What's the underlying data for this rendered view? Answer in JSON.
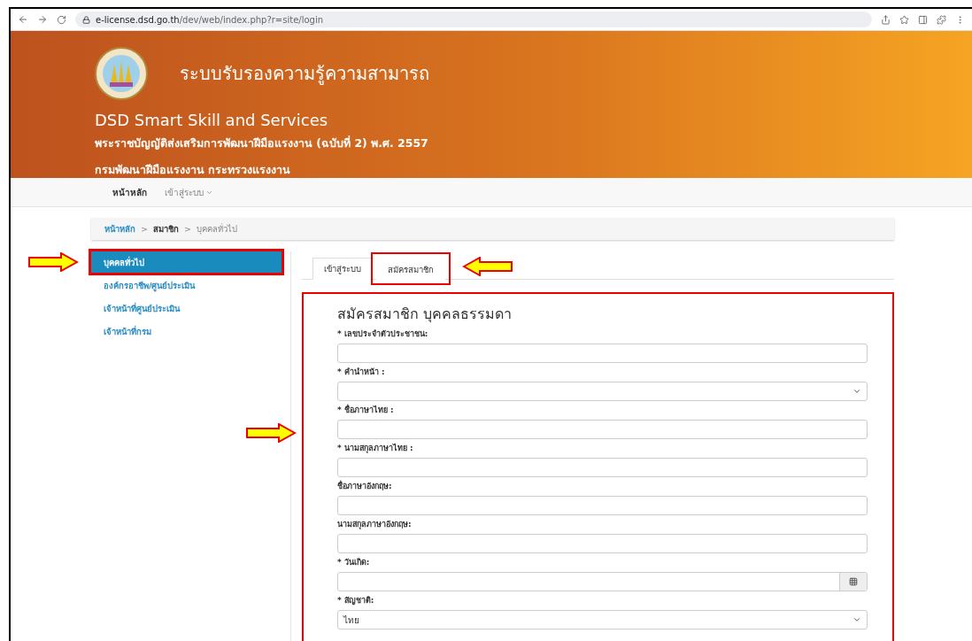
{
  "browser": {
    "url_host": "e-license.dsd.go.th",
    "url_path": "/dev/web/index.php?r=site/login"
  },
  "header": {
    "title": "ระบบรับรองความรู้ความสามารถ",
    "subtitle": "DSD Smart Skill and Services",
    "act": "พระราชบัญญัติส่งเสริมการพัฒนาฝีมือแรงงาน (ฉบับที่ 2) พ.ศ. 2557",
    "department": "กรมพัฒนาฝีมือแรงงาน กระทรวงแรงงาน"
  },
  "nav": [
    {
      "label": "หน้าหลัก",
      "selected": true,
      "dropdown": false
    },
    {
      "label": "เข้าสู่ระบบ",
      "selected": false,
      "dropdown": true
    }
  ],
  "breadcrumb_separator": ">",
  "breadcrumb": [
    {
      "label": "หน้าหลัก",
      "kind": "link"
    },
    {
      "label": "สมาชิก",
      "kind": "current"
    },
    {
      "label": "บุคคลทั่วไป",
      "kind": "plain"
    }
  ],
  "sidebar": [
    {
      "label": "บุคคลทั่วไป",
      "selected": true,
      "annotated": true
    },
    {
      "label": "องค์กรอาชีพ/ศูนย์ประเมิน",
      "selected": false,
      "annotated": false
    },
    {
      "label": "เจ้าหน้าที่ศูนย์ประเมิน",
      "selected": false,
      "annotated": false
    },
    {
      "label": "เจ้าหน้าที่กรม",
      "selected": false,
      "annotated": false
    }
  ],
  "tabs": [
    {
      "label": "เข้าสู่ระบบ",
      "selected": true,
      "annotated": false
    },
    {
      "label": "สมัครสมาชิก",
      "selected": false,
      "annotated": true
    }
  ],
  "form": {
    "title": "สมัครสมาชิก บุคคลธรรมดา",
    "annotated": true,
    "fields": [
      {
        "label": "* เลขประจำตัวประชาชน:",
        "kind": "text"
      },
      {
        "label": "* คำนำหน้า :",
        "kind": "select"
      },
      {
        "label": "* ชื่อภาษาไทย :",
        "kind": "text"
      },
      {
        "label": "* นามสกุลภาษาไทย :",
        "kind": "text"
      },
      {
        "label": "ชื่อภาษาอังกฤษ:",
        "kind": "text"
      },
      {
        "label": "นามสกุลภาษาอังกฤษ:",
        "kind": "text"
      },
      {
        "label": "* วันเกิด:",
        "kind": "date"
      },
      {
        "label": "* สัญชาติ:",
        "kind": "select",
        "value": "ไทย"
      }
    ]
  }
}
